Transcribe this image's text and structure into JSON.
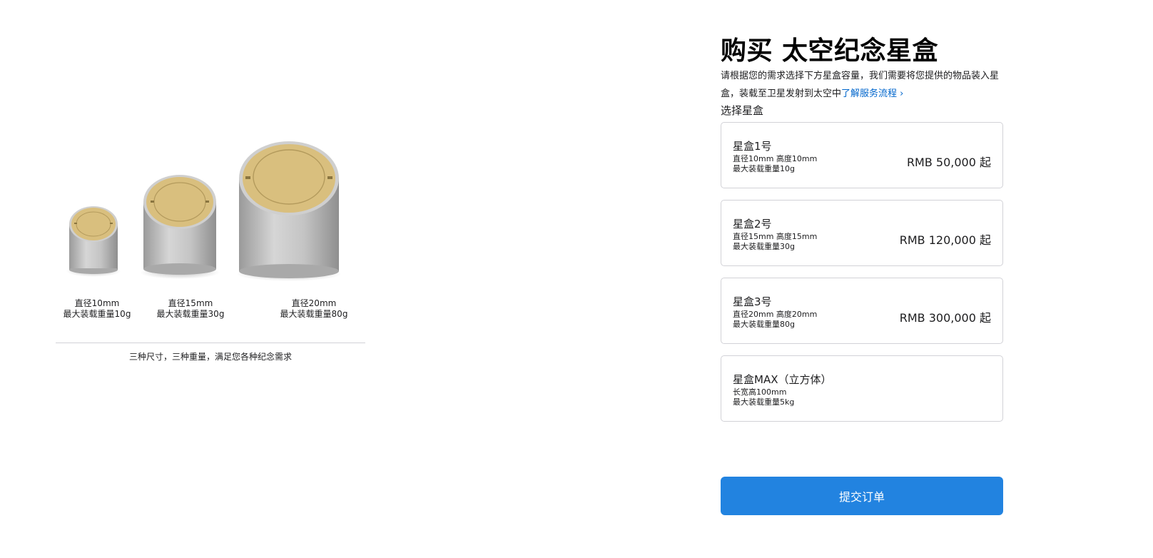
{
  "header": {
    "title": "购买 太空纪念星盒",
    "intro_text": "请根据您的需求选择下方星盒容量，我们需要将您提供的物品装入星盒，装载至卫星发射到太空中",
    "intro_link": "了解服务流程 ›",
    "section_label": "选择星盒"
  },
  "showcase": {
    "products": [
      {
        "name": "small-capsule",
        "diameter": "直径10mm",
        "capacity": "最大装载重量10g"
      },
      {
        "name": "medium-capsule",
        "diameter": "直径15mm",
        "capacity": "最大装载重量30g"
      },
      {
        "name": "large-capsule",
        "diameter": "直径20mm",
        "capacity": "最大装载重量80g"
      }
    ],
    "footnote": "三种尺寸，三种重量，满足您各种纪念需求"
  },
  "options": [
    {
      "name": "星盒1号",
      "spec_line1": "直径10mm 高度10mm",
      "spec_line2": "最大装载重量10g",
      "price": "RMB 50,000 起"
    },
    {
      "name": "星盒2号",
      "spec_line1": "直径15mm 高度15mm",
      "spec_line2": "最大装载重量30g",
      "price": "RMB 120,000 起"
    },
    {
      "name": "星盒3号",
      "spec_line1": "直径20mm 高度20mm",
      "spec_line2": "最大装载重量80g",
      "price": "RMB 300,000 起"
    },
    {
      "name": "星盒MAX（立方体）",
      "spec_line1": "长宽高100mm",
      "spec_line2": "最大装载重量5kg",
      "price": ""
    }
  ],
  "actions": {
    "submit_label": "提交订单"
  },
  "colors": {
    "accent": "#2283e0",
    "link": "#0066cc",
    "border": "#d2d2d7",
    "capsule_lid": "#d9bf7e",
    "capsule_body": "#bdbdbd"
  }
}
